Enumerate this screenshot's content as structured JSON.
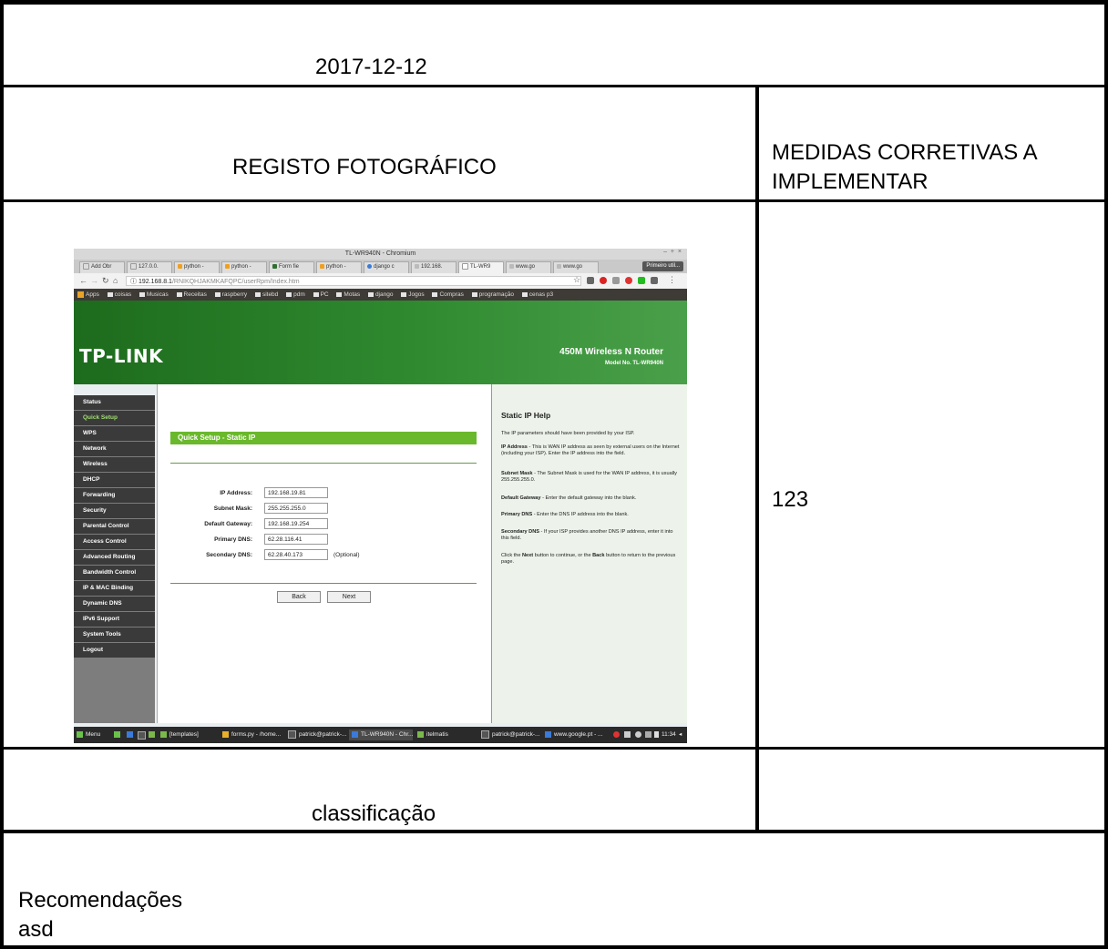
{
  "date": "2017-12-12",
  "photo_header": "REGISTO FOTOGRÁFICO",
  "measures_header_line1": "MEDIDAS CORRETIVAS A",
  "measures_header_line2": "IMPLEMENTAR",
  "measures_value": "123",
  "classification_label": "classificação",
  "recommendations_label": "Recomendações",
  "recommendations_value": "asd",
  "screenshot": {
    "window_title": "TL-WR940N - Chromium",
    "tabs": [
      "Add Obr",
      "127.0.0.",
      "python -",
      "python -",
      "Form fie",
      "python -",
      "django c",
      "192.168.",
      "TL-WR9",
      "www.go",
      "www.go"
    ],
    "profile_button": "Primeiro util...",
    "url_host": "192.168.8.1",
    "url_path": "/RNIKQHJAKMKAFQPC/userRpm/Index.htm",
    "bookmarks": [
      "coisas",
      "Musicas",
      "Receitas",
      "raspberry",
      "sitebd",
      "pdm",
      "PC",
      "Motas",
      "django",
      "Jogos",
      "Compras",
      "programação",
      "cenas p3"
    ],
    "apps_label": "Apps",
    "brand": "TP-LINK",
    "router_model": "450M Wireless N Router",
    "router_model_no": "Model No. TL-WR940N",
    "menu": [
      "Status",
      "Quick Setup",
      "WPS",
      "Network",
      "Wireless",
      "DHCP",
      "Forwarding",
      "Security",
      "Parental Control",
      "Access Control",
      "Advanced Routing",
      "Bandwidth Control",
      "IP & MAC Binding",
      "Dynamic DNS",
      "IPv6 Support",
      "System Tools",
      "Logout"
    ],
    "active_menu": "Quick Setup",
    "section_title": "Quick Setup - Static IP",
    "fields": [
      {
        "label": "IP Address:",
        "value": "192.168.19.81"
      },
      {
        "label": "Subnet Mask:",
        "value": "255.255.255.0"
      },
      {
        "label": "Default Gateway:",
        "value": "192.168.19.254"
      },
      {
        "label": "Primary DNS:",
        "value": "62.28.116.41"
      },
      {
        "label": "Secondary DNS:",
        "value": "62.28.40.173"
      }
    ],
    "optional_note": "(Optional)",
    "back_label": "Back",
    "next_label": "Next",
    "help": {
      "title": "Static IP Help",
      "intro": "The IP parameters should have been provided by your ISP.",
      "ip_term": "IP Address",
      "ip_text": " - This is WAN IP address as seen by external users on the Internet (including your ISP). Enter the IP address into the field.",
      "mask_term": "Subnet Mask",
      "mask_text": " - The Subnet Mask is used for the WAN IP address, it is usually 255.255.255.0.",
      "gw_term": "Default Gateway",
      "gw_text": " - Enter the default gateway into the blank.",
      "pdns_term": "Primary DNS",
      "pdns_text": " - Enter the DNS IP address into the blank.",
      "sdns_term": "Secondary DNS",
      "sdns_text": " - If your ISP provides another DNS IP address, enter it into this field.",
      "nav_text_1": "Click the ",
      "nav_next": "Next",
      "nav_text_2": " button to continue, or the ",
      "nav_back": "Back",
      "nav_text_3": " button to return to the previous page."
    },
    "taskbar": {
      "menu": "Menu",
      "items": [
        "[templates]",
        "forms.py - /home...",
        "patrick@patrick-...",
        "TL-WR940N - Chr...",
        "itelmatis",
        "patrick@patrick-...",
        "www.google.pt - ..."
      ],
      "clock": "11:34"
    }
  }
}
